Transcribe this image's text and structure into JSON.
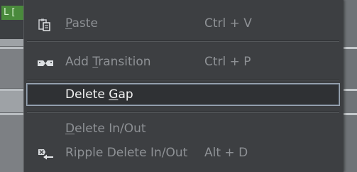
{
  "background": {
    "track_label": "L [",
    "colors": {
      "track_label_bg": "#4a8a3c",
      "timeline_bg": "#8a8d90"
    }
  },
  "menu": {
    "items": [
      {
        "label_pre": "",
        "label_key": "P",
        "label_post": "aste",
        "shortcut": "Ctrl + V",
        "icon": "paste-icon",
        "enabled": false
      },
      {
        "label_pre": "Add ",
        "label_key": "T",
        "label_post": "ransition",
        "shortcut": "Ctrl + P",
        "icon": "transition-icon",
        "enabled": false
      },
      {
        "label_pre": "Delete ",
        "label_key": "G",
        "label_post": "ap",
        "shortcut": "",
        "icon": "",
        "enabled": true,
        "highlighted": true
      },
      {
        "label_pre": "",
        "label_key": "D",
        "label_post": "elete In/Out",
        "shortcut": "",
        "icon": "",
        "enabled": false
      },
      {
        "label_pre": "Ripple Delete In/Out",
        "label_key": "",
        "label_post": "",
        "shortcut": "Alt + D",
        "icon": "ripple-delete-icon",
        "enabled": false
      }
    ],
    "colors": {
      "menu_bg": "#3d3f42",
      "disabled_text": "#8e9195",
      "active_text": "#f2f2f2",
      "highlight_border": "#9aa6b4"
    }
  }
}
